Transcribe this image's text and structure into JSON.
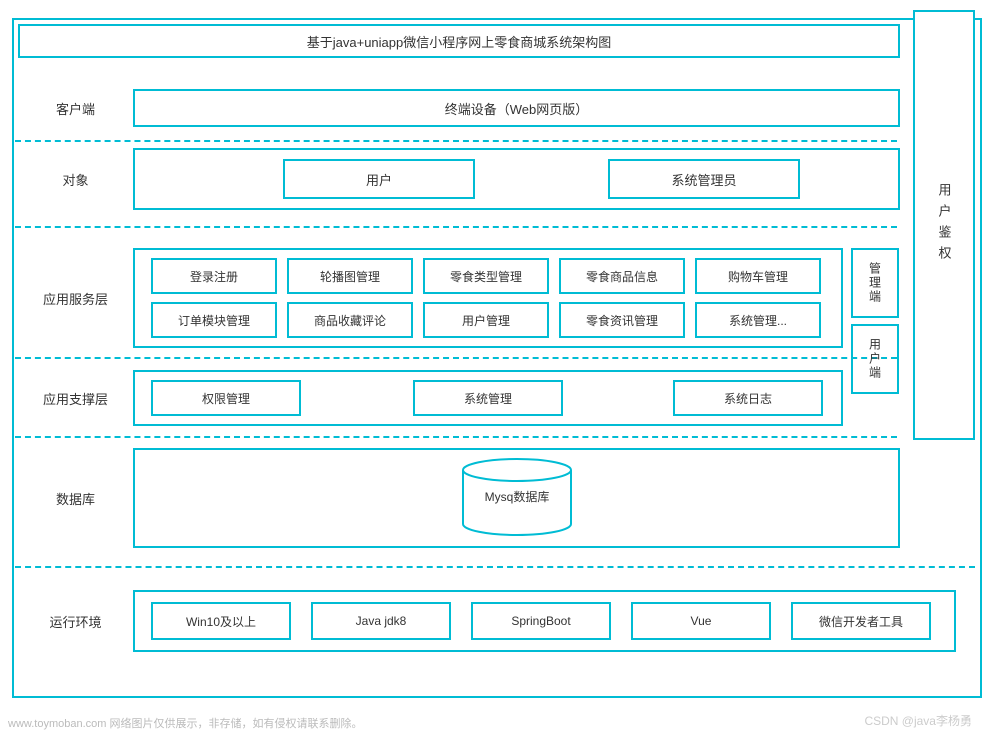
{
  "title": "基于java+uniapp微信小程序网上零食商城系统架构图",
  "rows": {
    "client": {
      "label": "客户端",
      "box": "终端设备（Web网页版）"
    },
    "object": {
      "label": "对象",
      "items": [
        "用户",
        "系统管理员"
      ]
    },
    "app_service": {
      "label": "应用服务层",
      "row1": [
        "登录注册",
        "轮播图管理",
        "零食类型管理",
        "零食商品信息",
        "购物车管理"
      ],
      "row2": [
        "订单模块管理",
        "商品收藏评论",
        "用户管理",
        "零食资讯管理",
        "系统管理..."
      ],
      "mgmt_side": "管理端",
      "user_side": "用户端"
    },
    "app_support": {
      "label": "应用支撑层",
      "items": [
        "权限管理",
        "系统管理",
        "系统日志"
      ]
    },
    "database": {
      "label": "数据库",
      "db": "Mysq数据库"
    },
    "runtime": {
      "label": "运行环境",
      "items": [
        "Win10及以上",
        "Java jdk8",
        "SpringBoot",
        "Vue",
        "微信开发者工具"
      ]
    }
  },
  "auth_box": "用户鉴权",
  "footer": {
    "left": "www.toymoban.com 网络图片仅供展示，非存储，如有侵权请联系删除。",
    "right": "CSDN @java李杨勇"
  },
  "colors": {
    "border": "#00bcd4"
  }
}
